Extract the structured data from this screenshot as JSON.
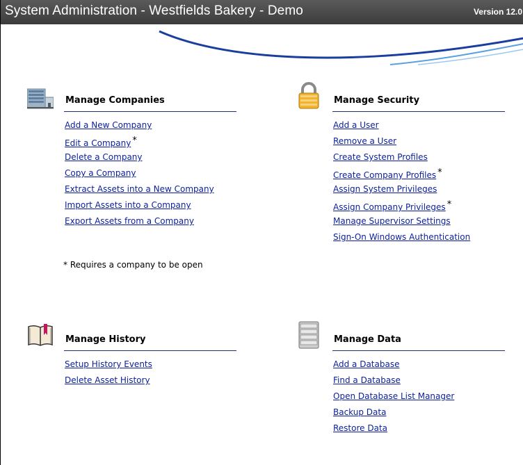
{
  "window": {
    "title": "System Administration - Westfields Bakery - Demo",
    "version": "Version 12.0"
  },
  "sections": {
    "companies": {
      "title": "Manage Companies",
      "icon": "building-icon",
      "links": [
        {
          "label": "Add a New Company",
          "star": ""
        },
        {
          "label": "Edit a Company",
          "star": "*"
        },
        {
          "label": "Delete a Company",
          "star": ""
        },
        {
          "label": "Copy a Company",
          "star": ""
        },
        {
          "label": "Extract Assets into a New Company",
          "star": ""
        },
        {
          "label": "Import Assets into a Company",
          "star": ""
        },
        {
          "label": "Export Assets from a Company",
          "star": ""
        }
      ]
    },
    "security": {
      "title": "Manage Security",
      "icon": "padlock-icon",
      "links": [
        {
          "label": "Add a User",
          "star": ""
        },
        {
          "label": "Remove a User",
          "star": ""
        },
        {
          "label": "Create System Profiles",
          "star": ""
        },
        {
          "label": "Create Company Profiles",
          "star": "*"
        },
        {
          "label": "Assign System Privileges",
          "star": ""
        },
        {
          "label": "Assign Company Privileges",
          "star": "*"
        },
        {
          "label": "Manage Supervisor Settings",
          "star": ""
        },
        {
          "label": "Sign-On Windows Authentication",
          "star": ""
        }
      ]
    },
    "history": {
      "title": "Manage History",
      "icon": "book-icon",
      "links": [
        {
          "label": "Setup History Events",
          "star": ""
        },
        {
          "label": "Delete Asset History",
          "star": ""
        }
      ]
    },
    "data": {
      "title": "Manage Data",
      "icon": "database-server-icon",
      "links": [
        {
          "label": "Add a Database",
          "star": ""
        },
        {
          "label": "Find a Database",
          "star": ""
        },
        {
          "label": "Open Database List Manager",
          "star": ""
        },
        {
          "label": "Backup Data",
          "star": ""
        },
        {
          "label": "Restore Data",
          "star": ""
        }
      ]
    }
  },
  "footnote": "* Requires a company to be open",
  "colors": {
    "link": "#0b1f9b",
    "rule": "#1f2f6e",
    "titlebar": "#4a4a4a",
    "swoosh": "#1a3e9e"
  }
}
